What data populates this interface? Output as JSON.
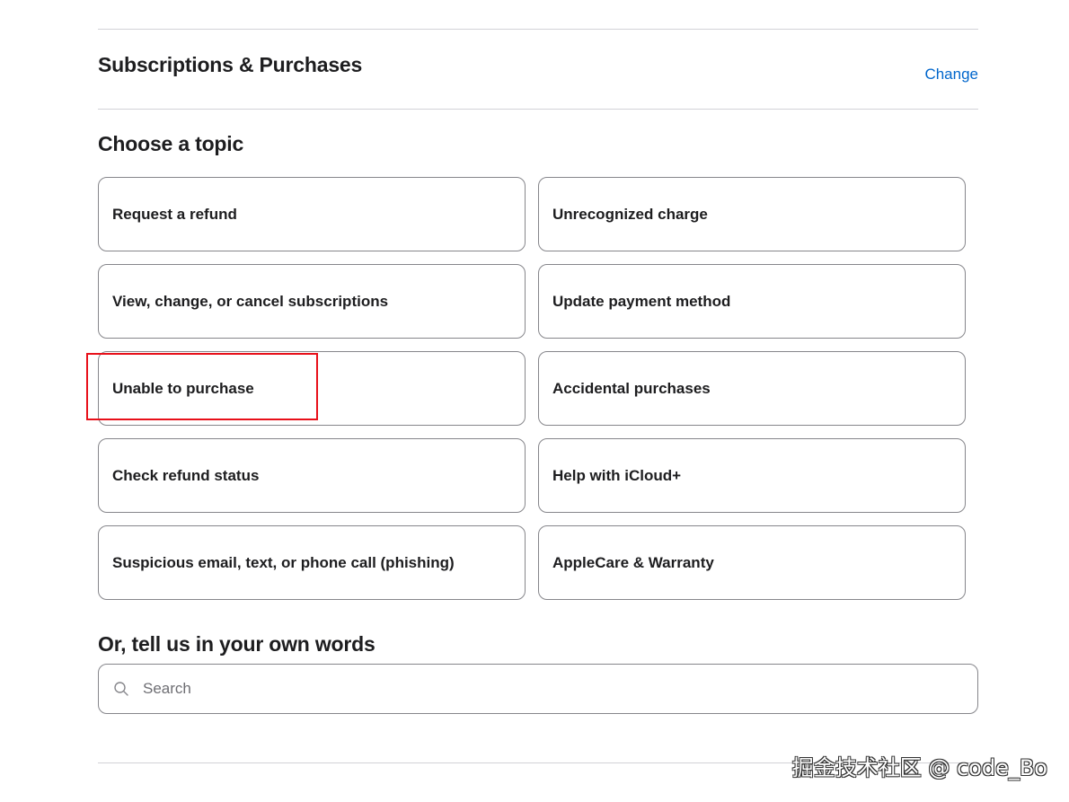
{
  "header": {
    "title": "Subscriptions & Purchases",
    "change_label": "Change"
  },
  "topics": {
    "title": "Choose a topic",
    "items": [
      {
        "label": "Request a refund"
      },
      {
        "label": "Unrecognized charge"
      },
      {
        "label": "View, change, or cancel subscriptions"
      },
      {
        "label": "Update payment method"
      },
      {
        "label": "Unable to purchase"
      },
      {
        "label": "Accidental purchases"
      },
      {
        "label": "Check refund status"
      },
      {
        "label": "Help with iCloud+"
      },
      {
        "label": "Suspicious email, text, or phone call (phishing)"
      },
      {
        "label": "AppleCare & Warranty"
      }
    ]
  },
  "own_words": {
    "title": "Or, tell us in your own words",
    "search_placeholder": "Search"
  },
  "watermark": "掘金技术社区 @ code_Bo",
  "colors": {
    "link": "#0066cc",
    "border": "#86868b",
    "divider": "#d2d2d7",
    "highlight": "#e8101a"
  }
}
